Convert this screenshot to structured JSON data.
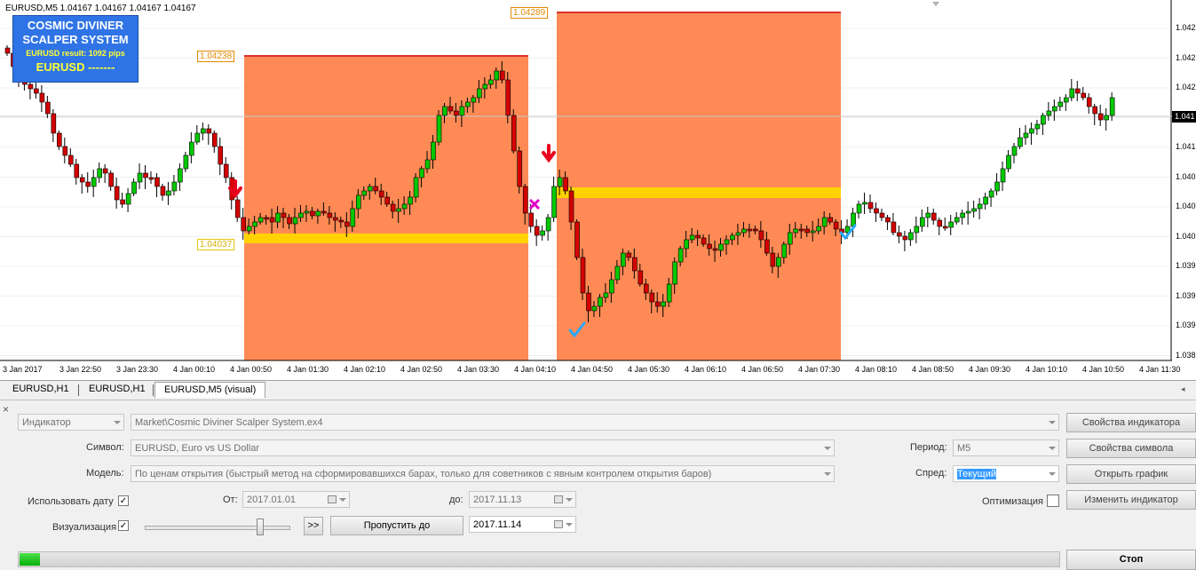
{
  "chart": {
    "header": "EURUSD,M5  1.04167 1.04167 1.04167 1.04167",
    "infobox": {
      "line1": "COSMIC DIVINER",
      "line2": "SCALPER SYSTEM",
      "line3": "EURUSD result: 1092 pips",
      "line4": "EURUSD   -------"
    },
    "price_tags": [
      "1.04238",
      "1.04289",
      "1.04037"
    ],
    "y_ticks": [
      "1.042",
      "1.042",
      "1.042",
      "1.041",
      "1.041",
      "1.040",
      "1.040",
      "1.040",
      "1.039",
      "1.039",
      "1.039",
      "1.038"
    ],
    "current_price": "1.041",
    "x_ticks": [
      "3 Jan 2017",
      "3 Jan 22:50",
      "3 Jan 23:30",
      "4 Jan 00:10",
      "4 Jan 00:50",
      "4 Jan 01:30",
      "4 Jan 02:10",
      "4 Jan 02:50",
      "4 Jan 03:30",
      "4 Jan 04:10",
      "4 Jan 04:50",
      "4 Jan 05:30",
      "4 Jan 06:10",
      "4 Jan 06:50",
      "4 Jan 07:30",
      "4 Jan 08:10",
      "4 Jan 08:50",
      "4 Jan 09:30",
      "4 Jan 10:10",
      "4 Jan 10:50",
      "4 Jan 11:30"
    ],
    "colors": {
      "bull": "#00c800",
      "bear": "#d40000",
      "zone": "#ff8a55",
      "level": "#ffd200",
      "signal": "#e8001c",
      "check": "#2aa8ff",
      "cross": "#e000c8"
    }
  },
  "tabs": [
    {
      "label": "EURUSD,H1",
      "active": false
    },
    {
      "label": "EURUSD,H1",
      "active": false
    },
    {
      "label": "EURUSD,M5 (visual)",
      "active": true
    }
  ],
  "panel": {
    "type_select": "Индикатор",
    "indicator_path": "Market\\Cosmic Diviner Scalper System.ex4",
    "symbol_label": "Символ:",
    "symbol_value": "EURUSD, Euro vs US Dollar",
    "model_label": "Модель:",
    "model_value": "По ценам открытия (быстрый метод на сформировавшихся барах, только для советников с явным контролем открытия баров)",
    "period_label": "Период:",
    "period_value": "M5",
    "spread_label": "Спред:",
    "spread_value": "Текущий",
    "use_date_label": "Использовать дату",
    "use_date_checked": "✓",
    "from_label": "От:",
    "from_value": "2017.01.01",
    "to_label": "до:",
    "to_value": "2017.11.13",
    "visual_label": "Визуализация",
    "visual_checked": "✓",
    "ff_label": ">>",
    "skip_label": "Пропустить до",
    "skip_date": "2017.11.14",
    "optimization_label": "Оптимизация",
    "buttons": {
      "indicator_props": "Свойства индикатора",
      "symbol_props": "Свойства символа",
      "open_chart": "Открыть график",
      "change_indicator": "Изменить индикатор",
      "stop": "Стоп"
    },
    "progress": 0.02
  }
}
